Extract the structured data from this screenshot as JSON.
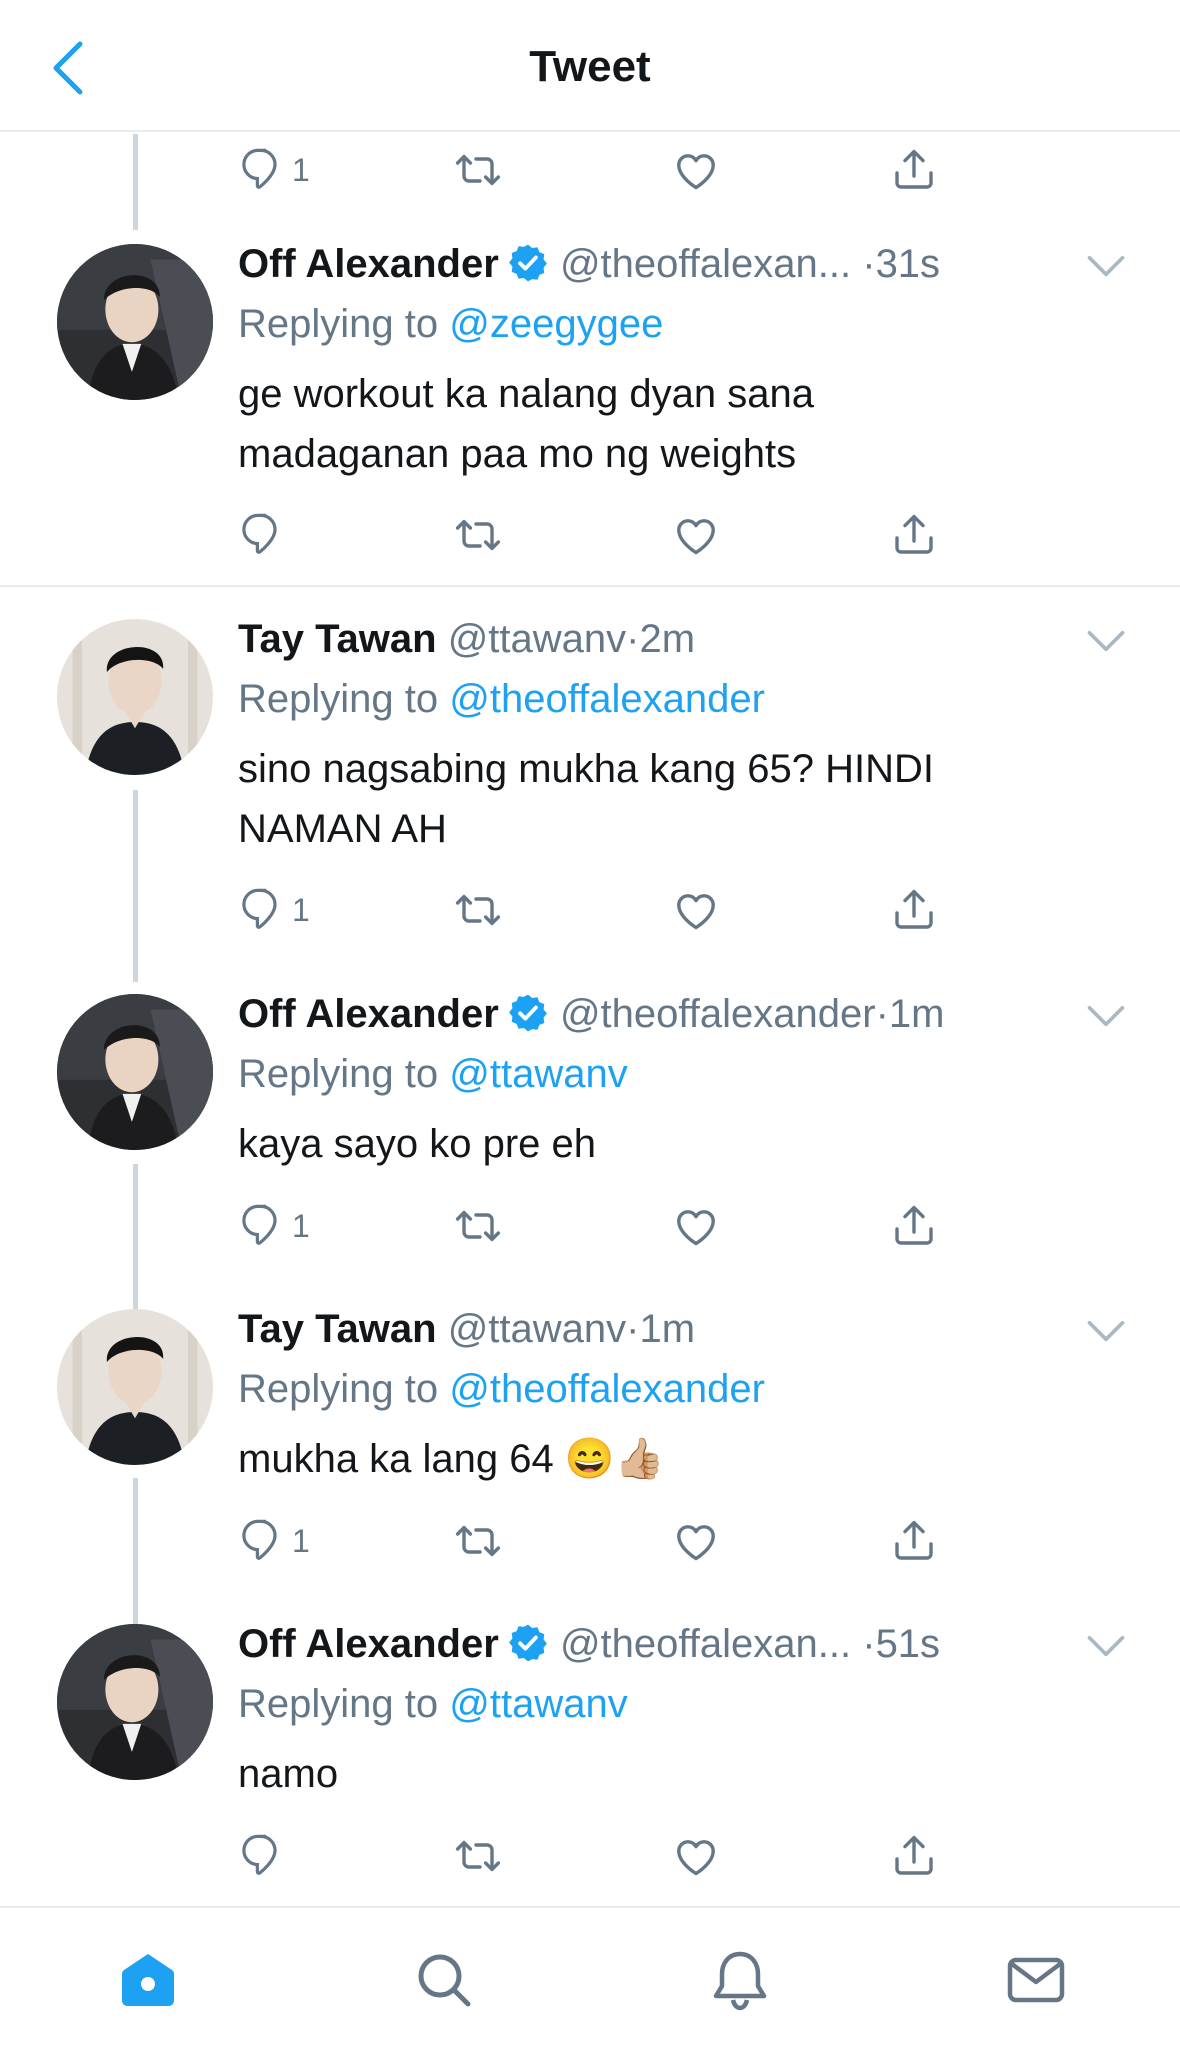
{
  "header": {
    "title": "Tweet"
  },
  "tweets": [
    {
      "text": "",
      "reply_count": "1"
    },
    {
      "name": "Off Alexander",
      "verified": true,
      "handle": "@theoffalexan...",
      "dot": "·",
      "time": "31s",
      "replying_prefix": "Replying to",
      "replying_to": "@zeegygee",
      "text_line1": "ge workout ka nalang dyan sana",
      "text_line2": "madaganan paa mo ng weights",
      "reply_count": ""
    },
    {
      "name": "Tay Tawan",
      "verified": false,
      "handle": "@ttawanv",
      "dot": "·",
      "time": "2m",
      "replying_prefix": "Replying to",
      "replying_to": "@theoffalexander",
      "text_line1": "sino nagsabing mukha kang 65? HINDI",
      "text_line2": "NAMAN AH",
      "reply_count": "1"
    },
    {
      "name": "Off Alexander",
      "verified": true,
      "handle": "@theoffalexander",
      "dot": "·",
      "time": "1m",
      "replying_prefix": "Replying to",
      "replying_to": "@ttawanv",
      "text_line1": "kaya sayo ko pre eh",
      "reply_count": "1"
    },
    {
      "name": "Tay Tawan",
      "verified": false,
      "handle": "@ttawanv",
      "dot": "·",
      "time": "1m",
      "replying_prefix": "Replying to",
      "replying_to": "@theoffalexander",
      "text_line1": "mukha ka lang 64 😄👍🏼",
      "reply_count": "1"
    },
    {
      "name": "Off Alexander",
      "verified": true,
      "handle": "@theoffalexan...",
      "dot": "·",
      "time": "51s",
      "replying_prefix": "Replying to",
      "replying_to": "@ttawanv",
      "text_line1": "namo",
      "reply_count": ""
    }
  ],
  "icons": {
    "back": "chevron-left-icon",
    "reply": "reply-icon",
    "retweet": "retweet-icon",
    "like": "heart-icon",
    "share": "share-icon",
    "caret": "chevron-down-icon",
    "verified": "verified-badge-icon",
    "home": "home-icon",
    "search": "search-icon",
    "notifications": "bell-icon",
    "messages": "mail-icon"
  },
  "colors": {
    "accent": "#1da1f2",
    "secondary_text": "#657786",
    "divider": "#e6ecf0",
    "thread_line": "#ccd6dd",
    "verified": "#1da1f2"
  }
}
